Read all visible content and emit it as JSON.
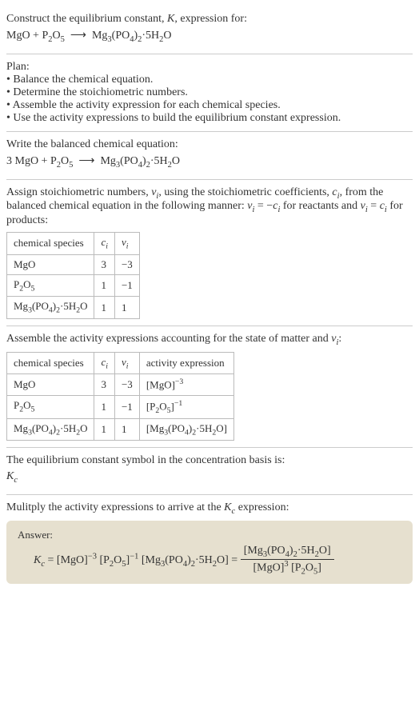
{
  "header": {
    "line1": "Construct the equilibrium constant, <i>K</i>, expression for:",
    "equation": "MgO + P<sub>2</sub>O<sub>5</sub> &nbsp;⟶&nbsp; Mg<sub>3</sub>(PO<sub>4</sub>)<sub>2</sub>·5H<sub>2</sub>O"
  },
  "plan": {
    "title": "Plan:",
    "items": [
      "• Balance the chemical equation.",
      "• Determine the stoichiometric numbers.",
      "• Assemble the activity expression for each chemical species.",
      "• Use the activity expressions to build the equilibrium constant expression."
    ]
  },
  "balanced": {
    "title": "Write the balanced chemical equation:",
    "equation": "3 MgO + P<sub>2</sub>O<sub>5</sub> &nbsp;⟶&nbsp; Mg<sub>3</sub>(PO<sub>4</sub>)<sub>2</sub>·5H<sub>2</sub>O"
  },
  "assign": {
    "text": "Assign stoichiometric numbers, <i>ν<sub>i</sub></i>, using the stoichiometric coefficients, <i>c<sub>i</sub></i>, from the balanced chemical equation in the following manner: <i>ν<sub>i</sub></i> = −<i>c<sub>i</sub></i> for reactants and <i>ν<sub>i</sub></i> = <i>c<sub>i</sub></i> for products:",
    "headers": [
      "chemical species",
      "<i>c<sub>i</sub></i>",
      "<i>ν<sub>i</sub></i>"
    ],
    "rows": [
      [
        "MgO",
        "3",
        "−3"
      ],
      [
        "P<sub>2</sub>O<sub>5</sub>",
        "1",
        "−1"
      ],
      [
        "Mg<sub>3</sub>(PO<sub>4</sub>)<sub>2</sub>·5H<sub>2</sub>O",
        "1",
        "1"
      ]
    ]
  },
  "activity": {
    "text": "Assemble the activity expressions accounting for the state of matter and <i>ν<sub>i</sub></i>:",
    "headers": [
      "chemical species",
      "<i>c<sub>i</sub></i>",
      "<i>ν<sub>i</sub></i>",
      "activity expression"
    ],
    "rows": [
      [
        "MgO",
        "3",
        "−3",
        "[MgO]<sup>−3</sup>"
      ],
      [
        "P<sub>2</sub>O<sub>5</sub>",
        "1",
        "−1",
        "[P<sub>2</sub>O<sub>5</sub>]<sup>−1</sup>"
      ],
      [
        "Mg<sub>3</sub>(PO<sub>4</sub>)<sub>2</sub>·5H<sub>2</sub>O",
        "1",
        "1",
        "[Mg<sub>3</sub>(PO<sub>4</sub>)<sub>2</sub>·5H<sub>2</sub>O]"
      ]
    ]
  },
  "basis": {
    "text": "The equilibrium constant symbol in the concentration basis is:",
    "symbol": "<i>K<sub>c</sub></i>"
  },
  "multiply": {
    "text": "Mulitply the activity expressions to arrive at the <i>K<sub>c</sub></i> expression:"
  },
  "answer": {
    "label": "Answer:",
    "lhs": "<i>K<sub>c</sub></i> = [MgO]<sup>−3</sup> [P<sub>2</sub>O<sub>5</sub>]<sup>−1</sup> [Mg<sub>3</sub>(PO<sub>4</sub>)<sub>2</sub>·5H<sub>2</sub>O] = ",
    "num": "[Mg<sub>3</sub>(PO<sub>4</sub>)<sub>2</sub>·5H<sub>2</sub>O]",
    "den": "[MgO]<sup>3</sup> [P<sub>2</sub>O<sub>5</sub>]"
  },
  "chart_data": {
    "type": "table",
    "tables": [
      {
        "title": "stoichiometric numbers",
        "columns": [
          "chemical species",
          "c_i",
          "ν_i"
        ],
        "rows": [
          [
            "MgO",
            3,
            -3
          ],
          [
            "P2O5",
            1,
            -1
          ],
          [
            "Mg3(PO4)2·5H2O",
            1,
            1
          ]
        ]
      },
      {
        "title": "activity expressions",
        "columns": [
          "chemical species",
          "c_i",
          "ν_i",
          "activity expression"
        ],
        "rows": [
          [
            "MgO",
            3,
            -3,
            "[MgO]^-3"
          ],
          [
            "P2O5",
            1,
            -1,
            "[P2O5]^-1"
          ],
          [
            "Mg3(PO4)2·5H2O",
            1,
            1,
            "[Mg3(PO4)2·5H2O]"
          ]
        ]
      }
    ]
  }
}
